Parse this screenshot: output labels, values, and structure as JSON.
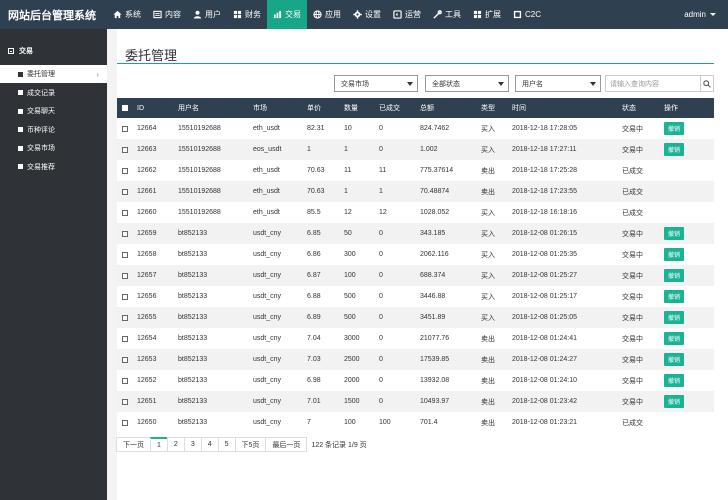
{
  "brand": "网站后台管理系统",
  "nav": [
    {
      "label": "系统",
      "icon": "home-icon"
    },
    {
      "label": "内容",
      "icon": "content-icon"
    },
    {
      "label": "用户",
      "icon": "user-icon"
    },
    {
      "label": "财务",
      "icon": "finance-icon"
    },
    {
      "label": "交易",
      "icon": "trade-icon",
      "active": true
    },
    {
      "label": "应用",
      "icon": "globe-icon"
    },
    {
      "label": "设置",
      "icon": "gear-icon"
    },
    {
      "label": "运营",
      "icon": "operations-icon"
    },
    {
      "label": "工具",
      "icon": "wrench-icon"
    },
    {
      "label": "扩展",
      "icon": "extend-icon"
    },
    {
      "label": "C2C",
      "icon": "c2c-icon"
    }
  ],
  "user": "admin",
  "sidebar": {
    "section": "交易",
    "items": [
      {
        "label": "委托管理",
        "active": true
      },
      {
        "label": "成交记录"
      },
      {
        "label": "交易聊天"
      },
      {
        "label": "币种评论"
      },
      {
        "label": "交易市场"
      },
      {
        "label": "交易推荐"
      }
    ]
  },
  "page_title": "委托管理",
  "filters": {
    "market": "交易市场",
    "status": "全部状态",
    "field": "用户名",
    "search_placeholder": "请输入查询内容"
  },
  "table": {
    "headers": [
      "ID",
      "用户名",
      "市场",
      "单价",
      "数量",
      "已成交",
      "总额",
      "类型",
      "时间",
      "状态",
      "操作"
    ],
    "rows": [
      {
        "id": "12664",
        "user": "15510192688",
        "market": "eth_usdt",
        "price": "82.31",
        "qty": "10",
        "done": "0",
        "total": "824.7462",
        "type": "买入",
        "time": "2018-12-18 17:28:05",
        "status": "交易中",
        "action": "撤销"
      },
      {
        "id": "12663",
        "user": "15510192688",
        "market": "eos_usdt",
        "price": "1",
        "qty": "1",
        "done": "0",
        "total": "1.002",
        "type": "买入",
        "time": "2018-12-18 17:27:11",
        "status": "交易中",
        "action": "撤销"
      },
      {
        "id": "12662",
        "user": "15510192688",
        "market": "eth_usdt",
        "price": "70.63",
        "qty": "11",
        "done": "11",
        "total": "775.37614",
        "type": "卖出",
        "time": "2018-12-18 17:25:28",
        "status": "已成交",
        "action": ""
      },
      {
        "id": "12661",
        "user": "15510192688",
        "market": "eth_usdt",
        "price": "70.63",
        "qty": "1",
        "done": "1",
        "total": "70.48874",
        "type": "卖出",
        "time": "2018-12-18 17:23:55",
        "status": "已成交",
        "action": ""
      },
      {
        "id": "12660",
        "user": "15510192688",
        "market": "eth_usdt",
        "price": "85.5",
        "qty": "12",
        "done": "12",
        "total": "1028.052",
        "type": "买入",
        "time": "2018-12-18 16:18:16",
        "status": "已成交",
        "action": ""
      },
      {
        "id": "12659",
        "user": "bt852133",
        "market": "usdt_cny",
        "price": "6.85",
        "qty": "50",
        "done": "0",
        "total": "343.185",
        "type": "买入",
        "time": "2018-12-08 01:26:15",
        "status": "交易中",
        "action": "撤销"
      },
      {
        "id": "12658",
        "user": "bt852133",
        "market": "usdt_cny",
        "price": "6.86",
        "qty": "300",
        "done": "0",
        "total": "2062.116",
        "type": "买入",
        "time": "2018-12-08 01:25:35",
        "status": "交易中",
        "action": "撤销"
      },
      {
        "id": "12657",
        "user": "bt852133",
        "market": "usdt_cny",
        "price": "6.87",
        "qty": "100",
        "done": "0",
        "total": "688.374",
        "type": "买入",
        "time": "2018-12-08 01:25:27",
        "status": "交易中",
        "action": "撤销"
      },
      {
        "id": "12656",
        "user": "bt852133",
        "market": "usdt_cny",
        "price": "6.88",
        "qty": "500",
        "done": "0",
        "total": "3446.88",
        "type": "买入",
        "time": "2018-12-08 01:25:17",
        "status": "交易中",
        "action": "撤销"
      },
      {
        "id": "12655",
        "user": "bt852133",
        "market": "usdt_cny",
        "price": "6.89",
        "qty": "500",
        "done": "0",
        "total": "3451.89",
        "type": "买入",
        "time": "2018-12-08 01:25:05",
        "status": "交易中",
        "action": "撤销"
      },
      {
        "id": "12654",
        "user": "bt852133",
        "market": "usdt_cny",
        "price": "7.04",
        "qty": "3000",
        "done": "0",
        "total": "21077.76",
        "type": "卖出",
        "time": "2018-12-08 01:24:41",
        "status": "交易中",
        "action": "撤销"
      },
      {
        "id": "12653",
        "user": "bt852133",
        "market": "usdt_cny",
        "price": "7.03",
        "qty": "2500",
        "done": "0",
        "total": "17539.85",
        "type": "卖出",
        "time": "2018-12-08 01:24:27",
        "status": "交易中",
        "action": "撤销"
      },
      {
        "id": "12652",
        "user": "bt852133",
        "market": "usdt_cny",
        "price": "6.98",
        "qty": "2000",
        "done": "0",
        "total": "13932.08",
        "type": "卖出",
        "time": "2018-12-08 01:24:10",
        "status": "交易中",
        "action": "撤销"
      },
      {
        "id": "12651",
        "user": "bt852133",
        "market": "usdt_cny",
        "price": "7.01",
        "qty": "1500",
        "done": "0",
        "total": "10493.97",
        "type": "卖出",
        "time": "2018-12-08 01:23:42",
        "status": "交易中",
        "action": "撤销"
      },
      {
        "id": "12650",
        "user": "bt852133",
        "market": "usdt_cny",
        "price": "7",
        "qty": "100",
        "done": "100",
        "total": "701.4",
        "type": "卖出",
        "time": "2018-12-08 01:23:21",
        "status": "已成交",
        "action": ""
      }
    ]
  },
  "pagination": {
    "prev": "下一页",
    "pages": [
      "1",
      "2",
      "3",
      "4",
      "5"
    ],
    "next5": "下5页",
    "last": "最后一页",
    "info": "122 条记录 1/9 页"
  },
  "colors": {
    "navbar": "#2f4050",
    "accent": "#18a689",
    "sidebar": "#2f3237",
    "button": "#1ab394"
  }
}
